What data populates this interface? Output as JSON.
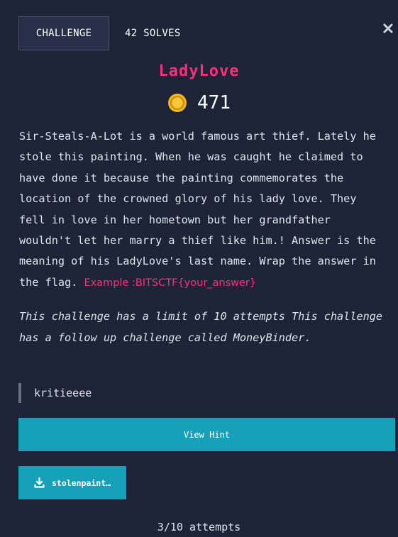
{
  "header": {
    "tab_label": "CHALLENGE",
    "solves_label": "42 SOLVES"
  },
  "challenge": {
    "title": "LadyLove",
    "points": "471",
    "description": "Sir-Steals-A-Lot is a world famous art thief. Lately he stole this painting. When he was caught he claimed to have done it because the painting commemorates the location of the crowned glory of his lady love. They fell in love in her hometown but her grandfather wouldn't let her marry a thief like him.! Answer is the meaning of his LadyLove's last name. Wrap the answer in the flag. ",
    "example": "Example :BITSCTF{your_answer}",
    "limit_note": "This challenge has a limit of 10 attempts This challenge has a follow up challenge called MoneyBinder.",
    "author": "kritieeee"
  },
  "actions": {
    "hint_label": "View Hint",
    "file_label": "stolenpaint…"
  },
  "status": {
    "attempts": "3/10 attempts"
  },
  "colors": {
    "background": "#1e2437",
    "accent_pink": "#ff2f7d",
    "button_teal": "#17a1b8",
    "coin_gold": "#f2b81c"
  },
  "icons": {
    "close": "close-icon",
    "coin": "coin-icon",
    "download": "download-icon"
  }
}
